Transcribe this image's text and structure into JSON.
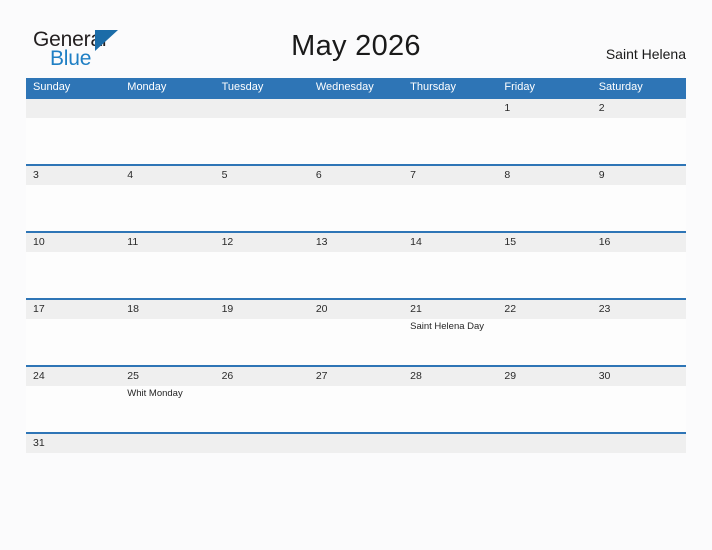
{
  "brand": {
    "name_part1": "General",
    "name_part2": "Blue",
    "triangle_icon": "blue-triangle-icon",
    "accent_color": "#1f7fc4"
  },
  "header": {
    "title": "May 2026",
    "region": "Saint Helena"
  },
  "theme": {
    "header_blue": "#2e75b6",
    "row_band_gray": "#efefef",
    "page_background": "#fbfbfc",
    "text_color": "#1a1a1a"
  },
  "calendar": {
    "month": "May",
    "year": "2026",
    "weekdays": [
      "Sunday",
      "Monday",
      "Tuesday",
      "Wednesday",
      "Thursday",
      "Friday",
      "Saturday"
    ],
    "weeks": [
      [
        {
          "day": "",
          "events": []
        },
        {
          "day": "",
          "events": []
        },
        {
          "day": "",
          "events": []
        },
        {
          "day": "",
          "events": []
        },
        {
          "day": "",
          "events": []
        },
        {
          "day": "1",
          "events": []
        },
        {
          "day": "2",
          "events": []
        }
      ],
      [
        {
          "day": "3",
          "events": []
        },
        {
          "day": "4",
          "events": []
        },
        {
          "day": "5",
          "events": []
        },
        {
          "day": "6",
          "events": []
        },
        {
          "day": "7",
          "events": []
        },
        {
          "day": "8",
          "events": []
        },
        {
          "day": "9",
          "events": []
        }
      ],
      [
        {
          "day": "10",
          "events": []
        },
        {
          "day": "11",
          "events": []
        },
        {
          "day": "12",
          "events": []
        },
        {
          "day": "13",
          "events": []
        },
        {
          "day": "14",
          "events": []
        },
        {
          "day": "15",
          "events": []
        },
        {
          "day": "16",
          "events": []
        }
      ],
      [
        {
          "day": "17",
          "events": []
        },
        {
          "day": "18",
          "events": []
        },
        {
          "day": "19",
          "events": []
        },
        {
          "day": "20",
          "events": []
        },
        {
          "day": "21",
          "events": [
            "Saint Helena Day"
          ]
        },
        {
          "day": "22",
          "events": []
        },
        {
          "day": "23",
          "events": []
        }
      ],
      [
        {
          "day": "24",
          "events": []
        },
        {
          "day": "25",
          "events": [
            "Whit Monday"
          ]
        },
        {
          "day": "26",
          "events": []
        },
        {
          "day": "27",
          "events": []
        },
        {
          "day": "28",
          "events": []
        },
        {
          "day": "29",
          "events": []
        },
        {
          "day": "30",
          "events": []
        }
      ],
      [
        {
          "day": "31",
          "events": []
        },
        {
          "day": "",
          "events": []
        },
        {
          "day": "",
          "events": []
        },
        {
          "day": "",
          "events": []
        },
        {
          "day": "",
          "events": []
        },
        {
          "day": "",
          "events": []
        },
        {
          "day": "",
          "events": []
        }
      ]
    ]
  }
}
